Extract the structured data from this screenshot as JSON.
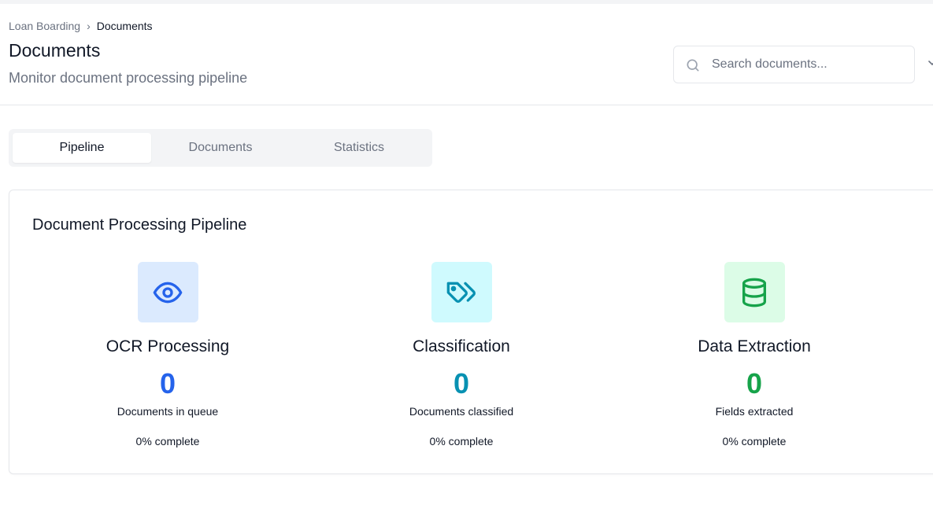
{
  "breadcrumb": {
    "parent": "Loan Boarding",
    "separator": "›",
    "current": "Documents"
  },
  "header": {
    "title": "Documents",
    "subtitle": "Monitor document processing pipeline"
  },
  "search": {
    "placeholder": "Search documents..."
  },
  "tabs": [
    {
      "label": "Pipeline",
      "active": true
    },
    {
      "label": "Documents",
      "active": false
    },
    {
      "label": "Statistics",
      "active": false
    }
  ],
  "pipeline": {
    "title": "Document Processing Pipeline",
    "stages": [
      {
        "icon": "eye-icon",
        "title": "OCR Processing",
        "count": "0",
        "label": "Documents in queue",
        "complete": "0% complete",
        "color": "#2563eb",
        "bg": "#dbeafe"
      },
      {
        "icon": "tags-icon",
        "title": "Classification",
        "count": "0",
        "label": "Documents classified",
        "complete": "0% complete",
        "color": "#0891b2",
        "bg": "#cffafe"
      },
      {
        "icon": "database-icon",
        "title": "Data Extraction",
        "count": "0",
        "label": "Fields extracted",
        "complete": "0% complete",
        "color": "#16a34a",
        "bg": "#dcfce7"
      }
    ]
  }
}
